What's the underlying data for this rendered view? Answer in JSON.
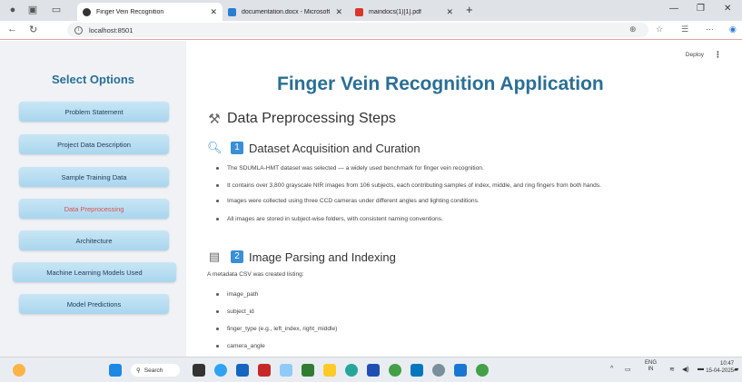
{
  "browser": {
    "tabs": [
      {
        "label": "Finger Vein Recognition",
        "active": true,
        "favicon_color": "#333333"
      },
      {
        "label": "documentation.docx - Microsoft",
        "active": false,
        "favicon_color": "#2b7cd3"
      },
      {
        "label": "maindocs(1)[1].pdf",
        "active": false,
        "favicon_color": "#d9362c"
      }
    ],
    "url": "localhost:8501"
  },
  "sidebar": {
    "title": "Select Options",
    "items": [
      {
        "label": "Problem Statement"
      },
      {
        "label": "Project Data Description"
      },
      {
        "label": "Sample Training Data"
      },
      {
        "label": "Data Preprocessing",
        "active": true
      },
      {
        "label": "Architecture"
      },
      {
        "label": "Machine Learning Models Used"
      },
      {
        "label": "Model Predictions"
      }
    ]
  },
  "main": {
    "deploy_label": "Deploy",
    "menu_icon": "⋮",
    "app_title": "Finger Vein Recognition Application",
    "section_title": "Data Preprocessing Steps",
    "step1": {
      "number": "1",
      "title": "Dataset Acquisition and Curation",
      "bullets": [
        "The SDUMLA-HMT dataset was selected — a widely used benchmark for finger vein recognition.",
        "It contains over 3,800 grayscale NIR images from 106 subjects, each contributing samples of index, middle, and ring fingers from both hands.",
        "Images were collected using three CCD cameras under different angles and lighting conditions.",
        "All images are stored in subject-wise folders, with consistent naming conventions."
      ]
    },
    "step2": {
      "number": "2",
      "title": "Image Parsing and Indexing",
      "intro": "A metadata CSV was created listing:",
      "bullets": [
        "image_path",
        "subject_id",
        "finger_type (e.g., left_index, right_middle)",
        "camera_angle"
      ]
    }
  },
  "taskbar": {
    "search_label": "Search",
    "lang": "ENG",
    "region": "IN",
    "time": "10:47",
    "date": "15-04-2025"
  }
}
